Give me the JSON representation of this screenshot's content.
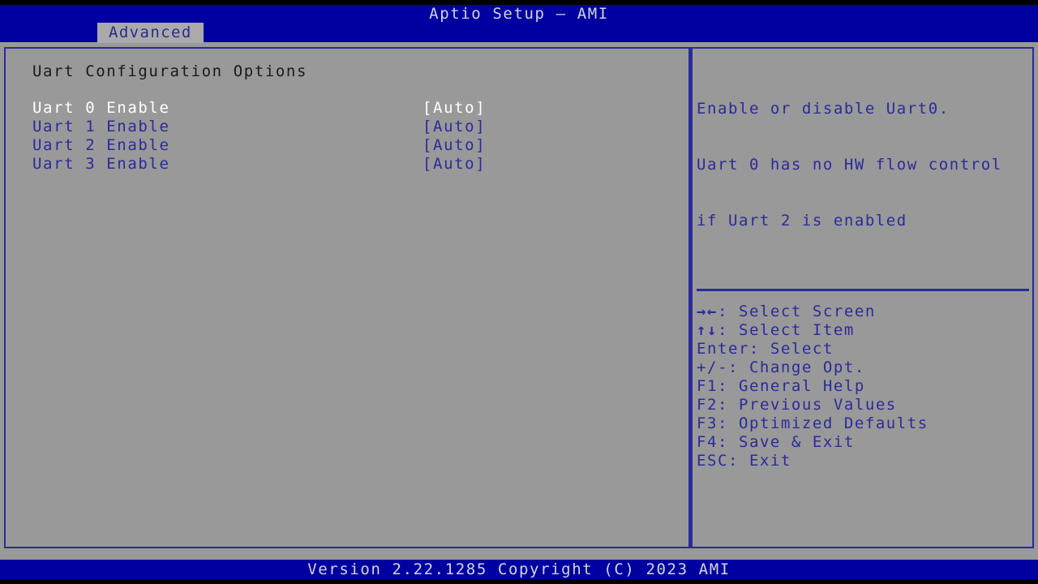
{
  "window": {
    "title": "Aptio Setup – AMI"
  },
  "colors": {
    "title_bar": "#0000a0",
    "background": "#999999",
    "border": "#2a2a9c",
    "text_blue": "#2a2a9c",
    "text_selected": "#ffffff",
    "text_heading": "#1a1a1a",
    "tab_active_bg": "#aaaaaa",
    "footer_bar": "#0000a0"
  },
  "menu": {
    "tabs": [
      {
        "label": "Advanced",
        "active": true
      }
    ]
  },
  "main": {
    "section_title": "Uart Configuration Options",
    "options": [
      {
        "label": "Uart 0 Enable",
        "value": "[Auto]",
        "selected": true
      },
      {
        "label": "Uart 1 Enable",
        "value": "[Auto]",
        "selected": false
      },
      {
        "label": "Uart 2 Enable",
        "value": "[Auto]",
        "selected": false
      },
      {
        "label": "Uart 3 Enable",
        "value": "[Auto]",
        "selected": false
      }
    ]
  },
  "help": {
    "lines": [
      "Enable or disable Uart0.",
      "Uart 0 has no HW flow control",
      "if Uart 2 is enabled"
    ]
  },
  "keys": [
    {
      "glyph": "→←",
      "text": ": Select Screen"
    },
    {
      "glyph": "↑↓",
      "text": ": Select Item"
    },
    {
      "glyph": "Enter",
      "text": ": Select"
    },
    {
      "glyph": "+/-",
      "text": ": Change Opt."
    },
    {
      "glyph": "F1",
      "text": ": General Help"
    },
    {
      "glyph": "F2",
      "text": ": Previous Values"
    },
    {
      "glyph": "F3",
      "text": ": Optimized Defaults"
    },
    {
      "glyph": "F4",
      "text": ": Save & Exit"
    },
    {
      "glyph": "ESC",
      "text": ": Exit"
    }
  ],
  "footer": {
    "version": "Version 2.22.1285 Copyright (C) 2023 AMI"
  }
}
